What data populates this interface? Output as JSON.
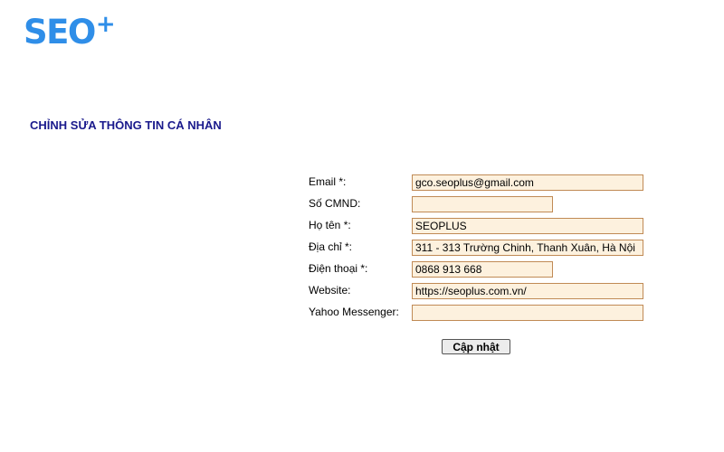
{
  "logo": {
    "text": "SEO",
    "plus": "+"
  },
  "heading": "CHỈNH SỬA THÔNG TIN CÁ NHÂN",
  "form": {
    "email": {
      "label": "Email *:",
      "value": "gco.seoplus@gmail.com"
    },
    "id_number": {
      "label": "Số CMND:",
      "value": ""
    },
    "full_name": {
      "label": "Họ tên *:",
      "value": "SEOPLUS"
    },
    "address": {
      "label": "Địa chỉ *:",
      "value": "311 - 313 Trường Chinh, Thanh Xuân, Hà Nội"
    },
    "phone": {
      "label": "Điện thoại *:",
      "value": "0868 913 668"
    },
    "website": {
      "label": "Website:",
      "value": "https://seoplus.com.vn/"
    },
    "yahoo": {
      "label": "Yahoo Messenger:",
      "value": ""
    }
  },
  "submit_label": "Cập nhật",
  "colors": {
    "logo": "#2f8ee8",
    "heading": "#1a1a8c",
    "input_background": "#fdf1de",
    "input_border": "#c08a55"
  }
}
